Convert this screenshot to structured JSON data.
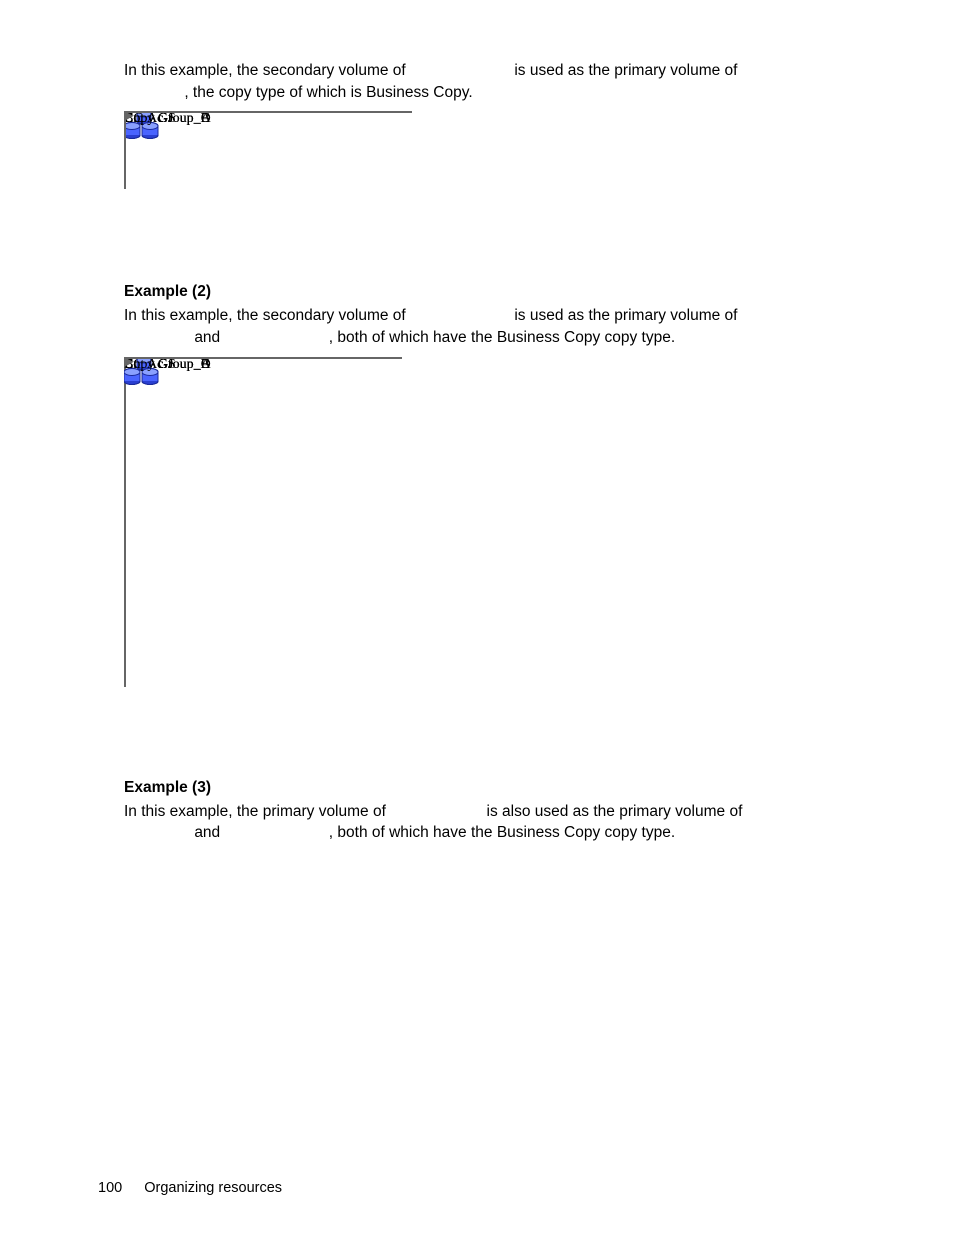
{
  "intro": {
    "line1_a": "In this example, the secondary volume of ",
    "line1_b": " is used as the primary volume of",
    "line2": ", the copy type of which is Business Copy."
  },
  "ex2": {
    "heading": "Example (2)",
    "line1_a": "In this example, the secondary volume of ",
    "line1_b": " is used as the primary volume of",
    "line2_a": " and ",
    "line2_b": ", both of which have the Business Copy copy type."
  },
  "ex3": {
    "heading": "Example (3)",
    "line1_a": "In this example, the primary volume of ",
    "line1_b": " is also used as the primary volume of",
    "line2_a": " and ",
    "line2_b": ", both of which have the Business Copy copy type."
  },
  "diag1": {
    "groupA": "Copy Group_A",
    "groupB": "Copy Group_B",
    "groupC": "Copy Group_C",
    "groupD": "Copy Group_D",
    "cntAcS": "Cnt Ac-S",
    "cntAcJ": "Cnt Ac-J",
    "bc": "BC"
  },
  "diag2": {
    "groupA": "Copy Group_A",
    "groupB": "Copy Group_B",
    "groupC": "Copy Group_C",
    "groupD": "Copy Group_D",
    "groupE": "Copy Group_E",
    "cntAcS": "Cnt Ac-S",
    "cntAcJ": "Cnt Ac-J",
    "bc": "BC"
  },
  "footer": {
    "page": "100",
    "chapter": "Organizing resources"
  }
}
